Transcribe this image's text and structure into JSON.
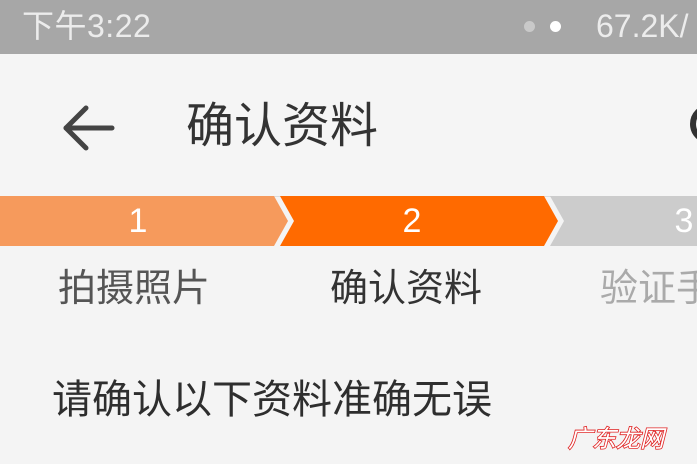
{
  "status_bar": {
    "time": "下午3:22",
    "network_speed": "67.2K/"
  },
  "header": {
    "back_icon": "arrow-left-icon",
    "title": "确认资料"
  },
  "steps": [
    {
      "number": "1",
      "label": "拍摄照片",
      "state": "completed"
    },
    {
      "number": "2",
      "label": "确认资料",
      "state": "active"
    },
    {
      "number": "3",
      "label": "验证手",
      "state": "pending"
    }
  ],
  "main": {
    "notice": "请确认以下资料准确无误"
  },
  "watermark": {
    "text": "广东龙网"
  },
  "colors": {
    "status_bar_bg": "#a7a7a7",
    "step_completed": "#f69a5c",
    "step_active": "#ff6a00",
    "step_pending": "#cccccc",
    "label_active": "#333333",
    "label_inactive": "#555555",
    "label_pending": "#aaaaaa",
    "watermark": "#e02020"
  }
}
